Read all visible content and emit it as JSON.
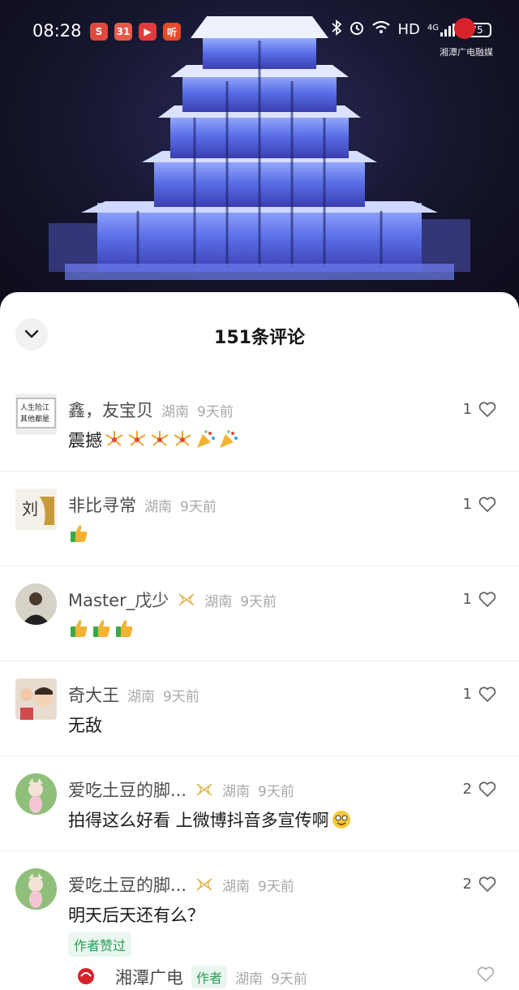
{
  "status_bar": {
    "time": "08:28",
    "apps": [
      {
        "name": "app-1",
        "label": "S",
        "color": "#e2483d"
      },
      {
        "name": "app-2",
        "label": "31",
        "color": "#ea5a4a"
      },
      {
        "name": "app-3",
        "label": "▶",
        "color": "#e23b3b"
      },
      {
        "name": "app-4",
        "label": "听",
        "color": "#e84a2a"
      }
    ],
    "network_label": "HD",
    "signal_label": "4G",
    "battery": "75"
  },
  "watermark": "湘潭广电融媒",
  "comments_panel": {
    "title": "151条评论",
    "comments": [
      {
        "username": "鑫，友宝贝",
        "region": "湖南",
        "time": "9天前",
        "text": "震撼",
        "likes": "1",
        "emoji": [
          "firework",
          "firework",
          "firework",
          "firework",
          "party",
          "party"
        ]
      },
      {
        "username": "非比寻常",
        "region": "湖南",
        "time": "9天前",
        "text": "",
        "likes": "1",
        "emoji": [
          "thumbs-up"
        ]
      },
      {
        "username": "Master_戊少",
        "region": "湖南",
        "time": "9天前",
        "text": "",
        "likes": "1",
        "emoji": [
          "thumbs-up",
          "thumbs-up",
          "thumbs-up"
        ],
        "badge": "vip-badge-icon"
      },
      {
        "username": "奇大王",
        "region": "湖南",
        "time": "9天前",
        "text": "无敌",
        "likes": "1",
        "emoji": []
      },
      {
        "username": "爱吃土豆的脚...",
        "region": "湖南",
        "time": "9天前",
        "text": "拍得这么好看 上微博抖音多宣传啊",
        "likes": "2",
        "emoji": [
          "grin"
        ],
        "badge": "vip-badge-icon"
      },
      {
        "username": "爱吃土豆的脚...",
        "region": "湖南",
        "time": "9天前",
        "text": "明天后天还有么？",
        "likes": "2",
        "emoji": [],
        "badge": "vip-badge-icon",
        "author_liked": "作者赞过"
      }
    ],
    "reply": {
      "username": "湘潭广电",
      "author_tag": "作者",
      "region": "湖南",
      "time": "9天前"
    }
  },
  "colors": {
    "accent_green": "#2a9c57",
    "sheet_bg": "#ffffff",
    "text_primary": "#1b1b1b",
    "text_secondary": "#a8a8a8"
  }
}
